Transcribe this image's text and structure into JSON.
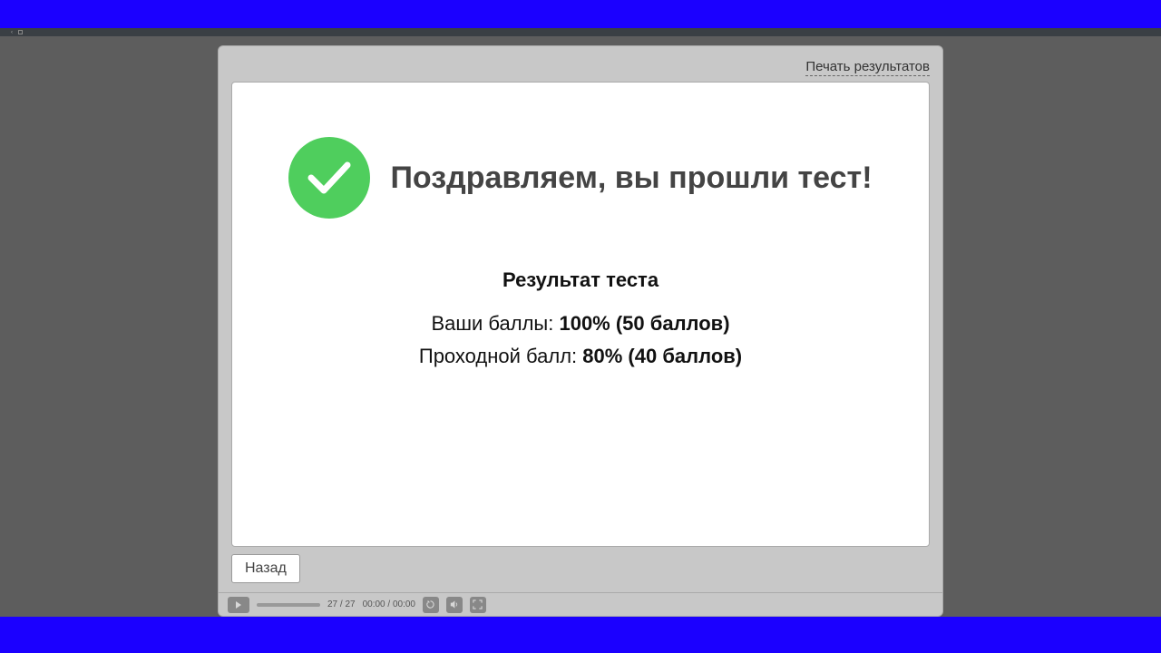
{
  "header": {
    "print_link": "Печать результатов"
  },
  "result": {
    "congrats": "Поздравляем, вы прошли тест!",
    "title": "Результат теста",
    "your_score_label": "Ваши баллы: ",
    "your_score_value": "100% (50 баллов)",
    "passing_score_label": "Проходной балл: ",
    "passing_score_value": "80% (40 баллов)"
  },
  "buttons": {
    "back": "Назад"
  },
  "player": {
    "slide_counter": "27 / 27",
    "time": "00:00 / 00:00"
  },
  "colors": {
    "blue_frame": "#1b00ff",
    "success_green": "#4fce5d",
    "panel_gray": "#c8c8c8",
    "bg_gray": "#5d5d5d"
  }
}
